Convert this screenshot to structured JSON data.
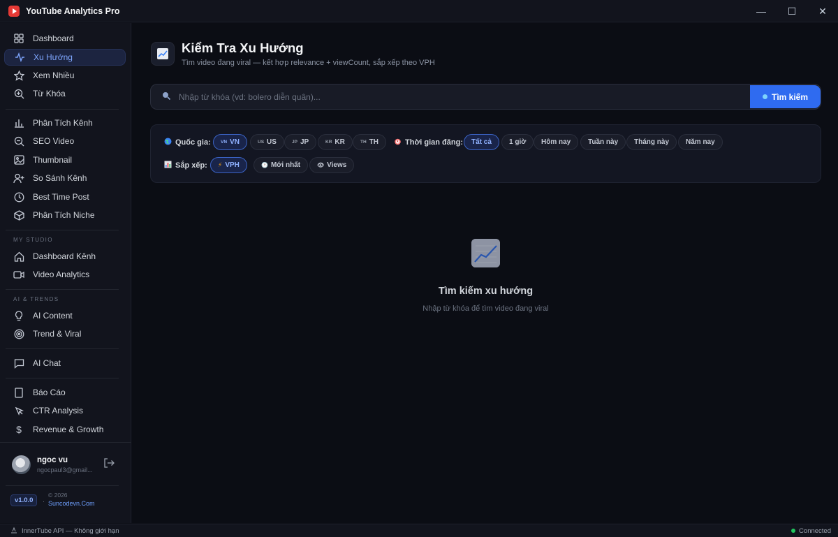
{
  "app": {
    "title": "YouTube Analytics Pro"
  },
  "window": {
    "minimize": "—",
    "maximize": "☐",
    "close": "✕"
  },
  "sidebar": {
    "items": [
      {
        "label": "Dashboard",
        "icon": "grid-icon"
      },
      {
        "label": "Xu Hướng",
        "icon": "activity-icon",
        "active": true
      },
      {
        "label": "Xem Nhiều",
        "icon": "star-icon"
      },
      {
        "label": "Từ Khóa",
        "icon": "search-plus-icon"
      },
      {
        "label": "Phân Tích Kênh",
        "icon": "bar-chart-icon"
      },
      {
        "label": "SEO Video",
        "icon": "search-icon"
      },
      {
        "label": "Thumbnail",
        "icon": "image-icon"
      },
      {
        "label": "So Sánh Kênh",
        "icon": "user-plus-icon"
      },
      {
        "label": "Best Time Post",
        "icon": "clock-icon"
      },
      {
        "label": "Phân Tích Niche",
        "icon": "box-icon"
      }
    ],
    "studio_label": "MY STUDIO",
    "studio_items": [
      {
        "label": "Dashboard Kênh",
        "icon": "home-icon"
      },
      {
        "label": "Video Analytics",
        "icon": "video-icon"
      }
    ],
    "ai_label": "AI & TRENDS",
    "ai_items": [
      {
        "label": "AI Content",
        "icon": "bulb-icon"
      },
      {
        "label": "Trend & Viral",
        "icon": "target-icon"
      }
    ],
    "chat_item": {
      "label": "AI Chat",
      "icon": "chat-icon"
    },
    "report_items": [
      {
        "label": "Báo Cáo",
        "icon": "report-icon"
      },
      {
        "label": "CTR Analysis",
        "icon": "cursor-icon"
      },
      {
        "label": "Revenue & Growth",
        "icon": "dollar-icon"
      }
    ],
    "user": {
      "name": "ngoc vu",
      "email": "ngocpaul3@gmail..."
    },
    "version": "v1.0.0",
    "copyright": "© 2026",
    "site": "Suncodevn.Com"
  },
  "header": {
    "title": "Kiểm Tra Xu Hướng",
    "subtitle": "Tìm video đang viral — kết hợp relevance + viewCount, sắp xếp theo VPH"
  },
  "search": {
    "placeholder": "Nhập từ khóa (vd: bolero diễn quân)...",
    "value": "",
    "button": "Tìm kiếm"
  },
  "filters": {
    "country_label": "Quốc gia:",
    "countries": [
      {
        "code": "VN",
        "flag": "VN",
        "selected": true
      },
      {
        "code": "US",
        "flag": "US"
      },
      {
        "code": "JP",
        "flag": "JP"
      },
      {
        "code": "KR",
        "flag": "KR"
      },
      {
        "code": "TH",
        "flag": "TH"
      }
    ],
    "time_label": "Thời gian đăng:",
    "times": [
      {
        "label": "Tất cả",
        "selected": true
      },
      {
        "label": "1 giờ"
      },
      {
        "label": "Hôm nay"
      },
      {
        "label": "Tuần này"
      },
      {
        "label": "Tháng này"
      },
      {
        "label": "Năm nay"
      }
    ],
    "sort_label": "Sắp xếp:",
    "sorts": [
      {
        "label": "VPH",
        "icon": "⚡",
        "selected": true
      },
      {
        "label": "Mới nhất",
        "icon": "🕐"
      },
      {
        "label": "Views",
        "icon": "👁"
      }
    ]
  },
  "empty_state": {
    "title": "Tìm kiếm xu hướng",
    "subtitle": "Nhập từ khóa để tìm video đang viral"
  },
  "status": {
    "left": "InnerTube API — Không giới hạn",
    "right": "Connected"
  }
}
